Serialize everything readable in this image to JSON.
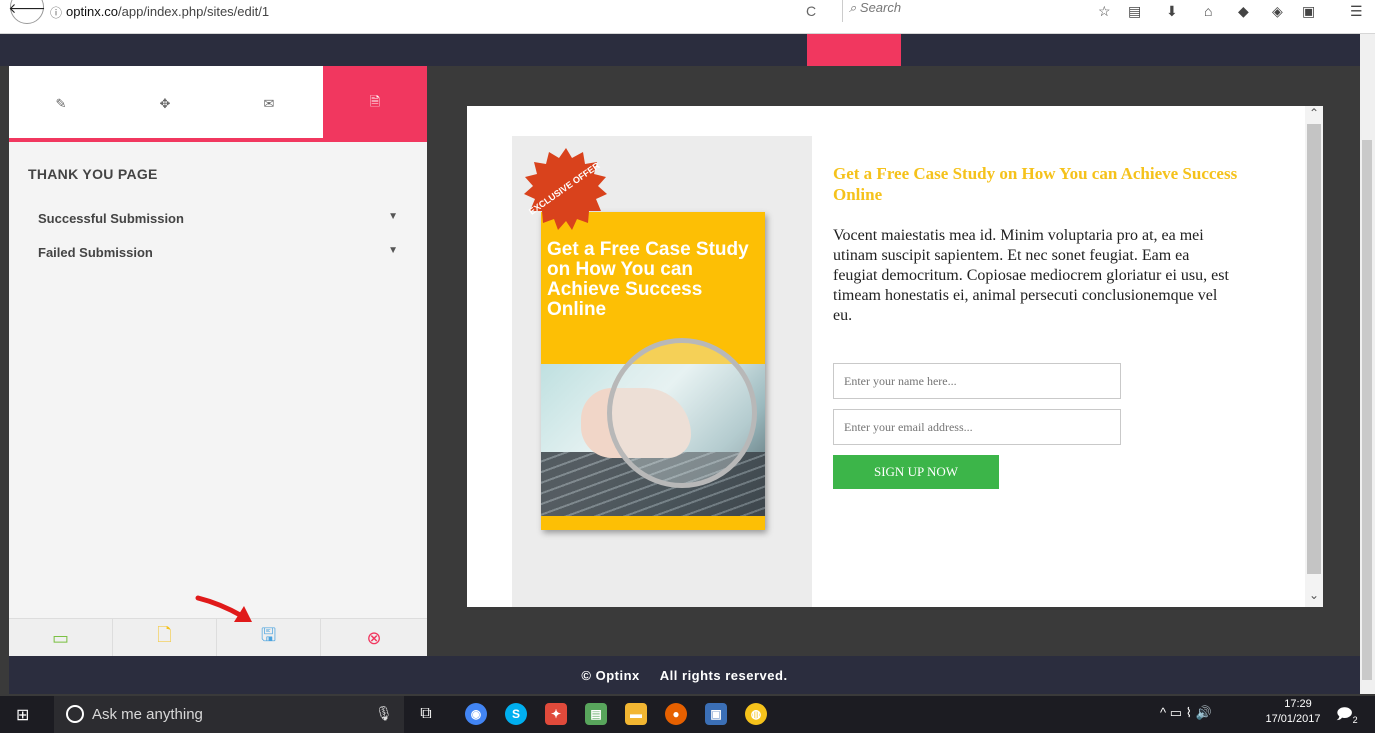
{
  "browser": {
    "url_host": "optinx.co",
    "url_path": "/app/index.php/sites/edit/1",
    "search_placeholder": "Search",
    "back_glyph": "🡐",
    "info_glyph": "ⓘ",
    "reload_glyph": "C",
    "toolbar_icons": [
      "star-icon",
      "reading-list-icon",
      "download-icon",
      "home-icon",
      "shield-icon",
      "extension-icon",
      "b-icon",
      "menu-icon"
    ]
  },
  "sidebar": {
    "tabs": [
      {
        "name": "edit-icon",
        "glyph": "✎"
      },
      {
        "name": "expand-icon",
        "glyph": "✥"
      },
      {
        "name": "mail-icon",
        "glyph": "✉"
      },
      {
        "name": "page-icon",
        "glyph": "🗎",
        "active": true
      }
    ],
    "section_title": "THANK YOU PAGE",
    "items": [
      {
        "label": "Successful Submission",
        "caret": "▼"
      },
      {
        "label": "Failed Submission",
        "caret": "▼"
      }
    ],
    "footer_buttons": [
      {
        "name": "devices-icon",
        "glyph": "▭",
        "color": "#7bc043"
      },
      {
        "name": "add-page-icon",
        "glyph": "🗋",
        "color": "#f5c21b"
      },
      {
        "name": "save-icon",
        "glyph": "🖫",
        "color": "#4aa3df"
      },
      {
        "name": "close-icon",
        "glyph": "⊗",
        "color": "#f1375f"
      }
    ]
  },
  "preview": {
    "badge": "EXCLUSIVE OFFER",
    "ebook_title": "Get a Free Case Study on How You can Achieve Success Online",
    "heading": "Get a Free Case Study on How You can Achieve Success Online",
    "body": "Vocent maiestatis mea id. Minim voluptaria pro at, ea mei utinam suscipit sapientem. Et nec sonet feugiat. Eam ea feugiat democritum. Copiosae mediocrem gloriatur ei usu, est timeam honestatis ei, animal persecuti conclusionemque vel eu.",
    "name_placeholder": "Enter your name here...",
    "email_placeholder": "Enter your email address...",
    "signup_label": "SIGN UP NOW",
    "scroll_up": "⌃",
    "scroll_down": "⌄"
  },
  "footer": {
    "copyright": "© Optinx",
    "rights": "All rights reserved."
  },
  "taskbar": {
    "start_glyph": "⊞",
    "search_text": "Ask me anything",
    "mic_glyph": "🎙",
    "apps": [
      {
        "name": "task-view-icon",
        "glyph": "⧉",
        "color": "#1c1c22"
      },
      {
        "name": "chrome-icon",
        "glyph": "◉",
        "color": "#4285f4"
      },
      {
        "name": "skype-icon",
        "glyph": "S",
        "color": "#00aff0"
      },
      {
        "name": "app-icon",
        "glyph": "✦",
        "color": "#e04a3b"
      },
      {
        "name": "photo-editor-icon",
        "glyph": "▤",
        "color": "#58a55c"
      },
      {
        "name": "file-explorer-icon",
        "glyph": "▬",
        "color": "#f2b632"
      },
      {
        "name": "firefox-icon",
        "glyph": "●",
        "color": "#e66000"
      },
      {
        "name": "document-icon",
        "glyph": "▣",
        "color": "#3b6fb6"
      },
      {
        "name": "sticky-icon",
        "glyph": "◍",
        "color": "#f5c21b"
      }
    ],
    "tray": "^ ▭ ⌇ 🔊",
    "time": "17:29",
    "date": "17/01/2017",
    "notif_glyph": "🗩",
    "notif_count": "2"
  }
}
